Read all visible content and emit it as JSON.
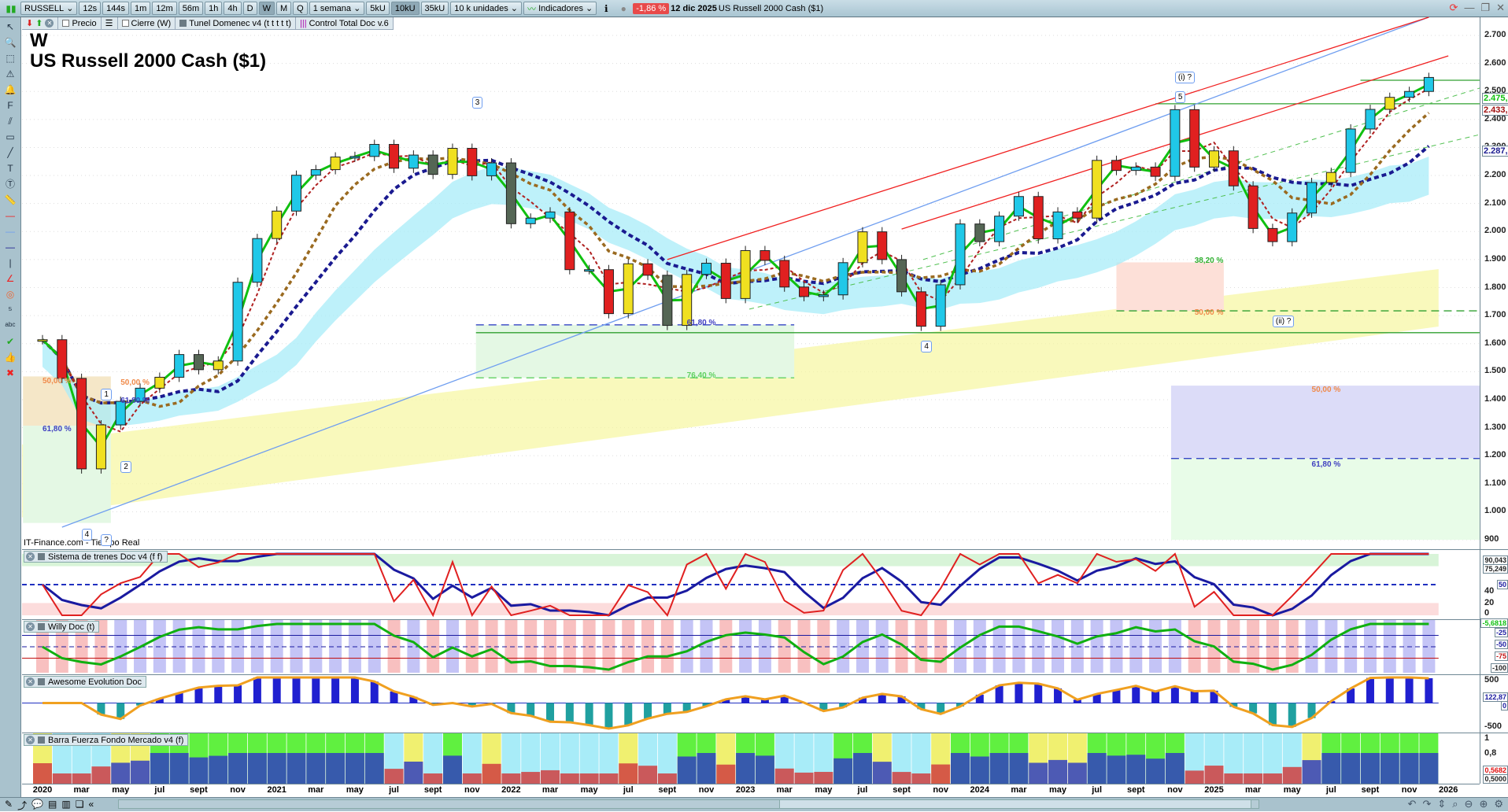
{
  "toolbar": {
    "symbol": "RUSSELL",
    "timeframes": [
      "12s",
      "144s",
      "1m",
      "12m",
      "56m",
      "1h",
      "4h",
      "D",
      "W",
      "M",
      "Q"
    ],
    "active_timeframe": "W",
    "period": "1 semana",
    "units": [
      "5kU",
      "10kU",
      "35kU"
    ],
    "active_unit": "10kU",
    "unit_select": "10 k unidades",
    "indicators": "Indicadores",
    "change": "-1,86 %",
    "date": "12 dic 2025",
    "instrument": "US Russell 2000 Cash ($1)"
  },
  "legend_bar": {
    "price": "Precio",
    "close": "Cierre (W)",
    "tunnel": "Tunel Domenec v4 (t t t t t)",
    "control": "Control Total Doc v.6"
  },
  "chart": {
    "timeframe_label": "W",
    "title": "US Russell 2000 Cash ($1)",
    "source": "IT-Finance.com - Tiempo Real",
    "y_ticks": [
      "2.700",
      "2.600",
      "2.500",
      "2.400",
      "2.300",
      "2.200",
      "2.100",
      "2.000",
      "1.900",
      "1.800",
      "1.700",
      "1.600",
      "1.500",
      "1.400",
      "1.300",
      "1.200",
      "1.100",
      "1.000",
      "900"
    ],
    "price_tags": [
      {
        "text": "2.475,7",
        "color": "#10c010",
        "value": 2475.7
      },
      {
        "text": "2.433,2",
        "color": "#a01010",
        "value": 2433.2
      },
      {
        "text": "2.287,3",
        "color": "#1a1a90",
        "value": 2287.3
      }
    ],
    "wave_labels": [
      {
        "t": "1",
        "d": "2020-04",
        "p": 1440
      },
      {
        "t": "2",
        "d": "2020-05",
        "p": 1180
      },
      {
        "t": "4",
        "d": "2020-03",
        "p": 940
      },
      {
        "t": "?",
        "d": "2020-04",
        "p": 920
      },
      {
        "t": "3",
        "d": "2021-11",
        "p": 2480
      },
      {
        "t": "(i) ?",
        "d": "2024-11",
        "p": 2570
      },
      {
        "t": "5",
        "d": "2024-11",
        "p": 2500
      },
      {
        "t": "4",
        "d": "2023-10",
        "p": 1610
      },
      {
        "t": "(ii) ?",
        "d": "2025-04",
        "p": 1700
      }
    ],
    "fib_labels": [
      {
        "t": "50,00 %",
        "d": "2020-01",
        "p": 1480,
        "c": "#f08a4a"
      },
      {
        "t": "61,80 %",
        "d": "2020-01",
        "p": 1310,
        "c": "#4040c0"
      },
      {
        "t": "50,00 %",
        "d": "2020-05",
        "p": 1475,
        "c": "#f08a4a"
      },
      {
        "t": "61,80 %",
        "d": "2020-05",
        "p": 1410,
        "c": "#4040c0"
      },
      {
        "t": "61,80 %",
        "d": "2022-10",
        "p": 1690,
        "c": "#4040c0"
      },
      {
        "t": "76,40 %",
        "d": "2022-10",
        "p": 1500,
        "c": "#60d060"
      },
      {
        "t": "38,20 %",
        "d": "2024-12",
        "p": 1910,
        "c": "#30b030"
      },
      {
        "t": "50,00 %",
        "d": "2024-12",
        "p": 1725,
        "c": "#f08a4a"
      },
      {
        "t": "50,00 %",
        "d": "2025-06",
        "p": 1450,
        "c": "#f08a4a"
      },
      {
        "t": "61,80 %",
        "d": "2025-06",
        "p": 1185,
        "c": "#4040c0"
      }
    ]
  },
  "chart_data": {
    "type": "candlestick",
    "x_start": "2020-01",
    "x_step": "month",
    "ylim": [
      900,
      2700
    ],
    "close": [
      1614,
      1476,
      1153,
      1310,
      1394,
      1441,
      1480,
      1561,
      1507,
      1538,
      1819,
      1975,
      2073,
      2201,
      2221,
      2266,
      2268,
      2311,
      2226,
      2273,
      2204,
      2297,
      2199,
      2245,
      2028,
      2048,
      2070,
      1864,
      1864,
      1707,
      1885,
      1844,
      1665,
      1847,
      1887,
      1761,
      1932,
      1897,
      1802,
      1768,
      1774,
      1889,
      1999,
      1900,
      1785,
      1662,
      1810,
      2027,
      1964,
      2055,
      2125,
      1974,
      2070,
      2048,
      2254,
      2218,
      2230,
      2197,
      2435,
      2230,
      2288,
      2163,
      2011,
      1964,
      2066,
      2175,
      2211,
      2366,
      2436,
      2479,
      2500,
      2550
    ],
    "trendlines": [
      {
        "from": [
          "2020-02",
          945
        ],
        "to": [
          "2025-12",
          2765
        ],
        "color": "#6f9ef0"
      },
      {
        "from": [
          "2022-09",
          1900
        ],
        "to": [
          "2025-12",
          2765
        ],
        "color": "#f02020"
      },
      {
        "from": [
          "2023-09",
          2009
        ],
        "to": [
          "2026-01",
          2627
        ],
        "color": "#f02020"
      }
    ],
    "colors": {
      "up": "#20c8e8",
      "down": "#e02020",
      "neutral": "#556655",
      "ma_fast": "#10c010",
      "ma_mid": "#b02020",
      "ma_slow": "#9a6a20",
      "ma_long": "#1a1a90"
    },
    "x_labels": [
      "2020",
      "mar",
      "may",
      "jul",
      "sept",
      "nov",
      "2021",
      "mar",
      "may",
      "jul",
      "sept",
      "nov",
      "2022",
      "mar",
      "may",
      "jul",
      "sept",
      "nov",
      "2023",
      "mar",
      "may",
      "jul",
      "sept",
      "nov",
      "2024",
      "mar",
      "may",
      "jul",
      "sept",
      "nov",
      "2025",
      "mar",
      "may",
      "jul",
      "sept",
      "nov",
      "2026"
    ]
  },
  "panels": [
    {
      "name": "Sistema de trenes Doc v4 (f f)",
      "ticks": [
        "40",
        "20",
        "0"
      ],
      "tags": [
        {
          "text": "90,043",
          "color": "#222"
        },
        {
          "text": "75,249",
          "color": "#222"
        },
        {
          "text": "50",
          "color": "#1a1aa0"
        }
      ]
    },
    {
      "name": "Willy Doc (t)",
      "ticks": [],
      "tags": [
        {
          "text": "-5,6818",
          "color": "#10c010"
        },
        {
          "text": "-25",
          "color": "#1a1aa0"
        },
        {
          "text": "-50",
          "color": "#1a1aa0"
        },
        {
          "text": "-75",
          "color": "#c01010"
        },
        {
          "text": "-100",
          "color": "#222"
        }
      ]
    },
    {
      "name": "Awesome Evolution Doc",
      "ticks": [
        "500",
        "-500"
      ],
      "tags": [
        {
          "text": "122,87",
          "color": "#1a1aa0"
        },
        {
          "text": "0",
          "color": "#1a1aa0"
        }
      ]
    },
    {
      "name": "Barra Fuerza Fondo Mercado v4 (f)",
      "ticks": [
        "1",
        "0,8"
      ],
      "tags": [
        {
          "text": "0,5682",
          "color": "#e01010"
        },
        {
          "text": "0,5000",
          "color": "#222"
        }
      ]
    }
  ],
  "left_tools": [
    "cursor",
    "zoom",
    "zoom-area",
    "alert",
    "alert-bell",
    "fibonacci",
    "trend-channel",
    "rectangle",
    "line",
    "text",
    "text-box",
    "measure",
    "line-red",
    "line-blue",
    "line-navy",
    "line-black",
    "angle",
    "circle",
    "elliott-waves",
    "abc-waves",
    "check",
    "thumbs-up",
    "delete"
  ]
}
